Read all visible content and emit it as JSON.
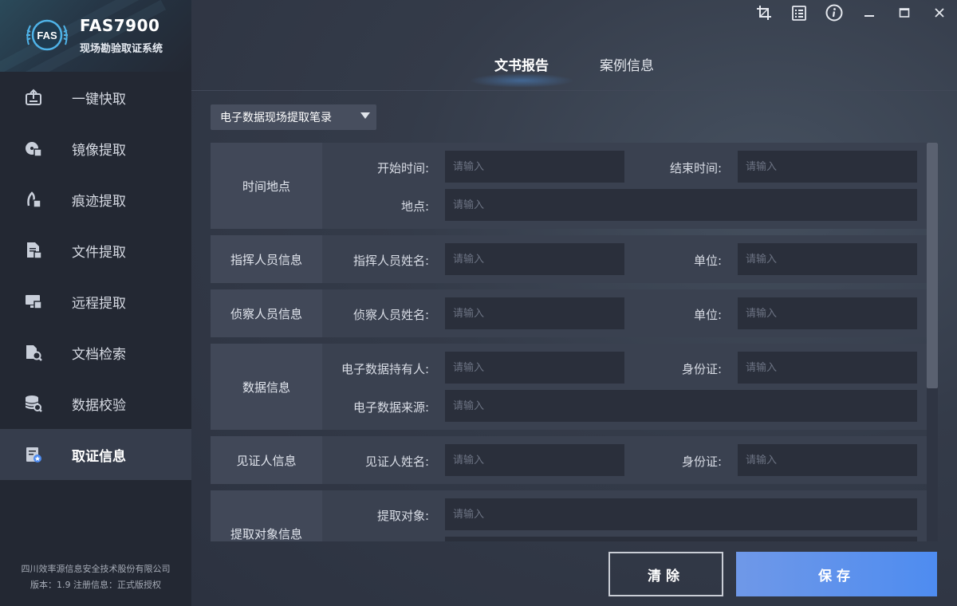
{
  "brand": {
    "logo_text": "FAS",
    "title": "FAS7900",
    "subtitle": "现场勘验取证系统"
  },
  "sidebar": {
    "items": [
      {
        "label": "一键快取",
        "icon": "upload-box-icon"
      },
      {
        "label": "镜像提取",
        "icon": "image-extract-icon"
      },
      {
        "label": "痕迹提取",
        "icon": "trace-icon"
      },
      {
        "label": "文件提取",
        "icon": "file-icon"
      },
      {
        "label": "远程提取",
        "icon": "remote-icon"
      },
      {
        "label": "文档检索",
        "icon": "doc-search-icon"
      },
      {
        "label": "数据校验",
        "icon": "database-check-icon"
      },
      {
        "label": "取证信息",
        "icon": "evidence-info-icon",
        "active": true
      }
    ],
    "footer": {
      "company": "四川效率源信息安全技术股份有限公司",
      "version_info": "版本：1.9   注册信息：正式版授权"
    }
  },
  "titlebar": {
    "icons": [
      "crop-icon",
      "list-icon",
      "info-icon",
      "minimize-icon",
      "maximize-icon",
      "close-icon"
    ]
  },
  "tabs": [
    {
      "label": "文书报告",
      "active": true
    },
    {
      "label": "案例信息",
      "active": false
    }
  ],
  "doc_type": {
    "selected": "电子数据现场提取笔录"
  },
  "form": {
    "placeholder": "请输入",
    "groups": {
      "time_place": {
        "title": "时间地点",
        "start_label": "开始时间:",
        "end_label": "结束时间:",
        "place_label": "地点:"
      },
      "commander": {
        "title": "指挥人员信息",
        "name_label": "指挥人员姓名:",
        "unit_label": "单位:"
      },
      "investigator": {
        "title": "侦察人员信息",
        "name_label": "侦察人员姓名:",
        "unit_label": "单位:"
      },
      "data_info": {
        "title": "数据信息",
        "holder_label": "电子数据持有人:",
        "id_label": "身份证:",
        "source_label": "电子数据来源:"
      },
      "witness": {
        "title": "见证人信息",
        "name_label": "见证人姓名:",
        "id_label": "身份证:"
      },
      "extract_target": {
        "title": "提取对象信息",
        "target_label": "提取对象:"
      }
    }
  },
  "buttons": {
    "clear": "清除",
    "save": "保存"
  },
  "colors": {
    "accent": "#4e8cf0",
    "sidebar_bg": "#232833",
    "active_item_bg": "#363d4c"
  }
}
